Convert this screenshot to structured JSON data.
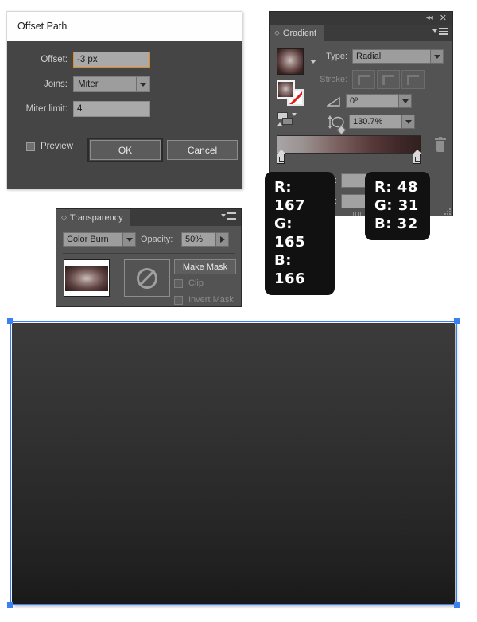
{
  "dialog": {
    "title": "Offset Path",
    "fields": [
      {
        "label": "Offset:",
        "value": "-3 px"
      },
      {
        "label": "Joins:",
        "value": "Miter"
      },
      {
        "label": "Miter limit:",
        "value": "4"
      }
    ],
    "preview_label": "Preview",
    "ok_label": "OK",
    "cancel_label": "Cancel"
  },
  "gradient_panel": {
    "tab_label": "Gradient",
    "type_label": "Type:",
    "type_value": "Radial",
    "stroke_label": "Stroke:",
    "angle_value": "0º",
    "aspect_value": "130.7%",
    "opacity_label": "ty:",
    "location_label": "n:",
    "collapse_icon": "◂◂",
    "close_icon": "✕",
    "gradient_start_color": "#a7a5a6",
    "gradient_end_color": "#302020"
  },
  "transparency_panel": {
    "tab_label": "Transparency",
    "blend_mode": "Color Burn",
    "opacity_label": "Opacity:",
    "opacity_value": "50%",
    "make_mask_label": "Make Mask",
    "clip_label": "Clip",
    "invert_mask_label": "Invert Mask"
  },
  "overlays": [
    {
      "name": "light-stop-rgb",
      "r": "R: 167",
      "g": "G: 165",
      "b": "B: 166"
    },
    {
      "name": "dark-stop-rgb",
      "r": "R: 48",
      "g": "G: 31",
      "b": "B: 32"
    }
  ],
  "artboard": {
    "selection_color": "#3b7ff0",
    "fill_top_color": "#3b3b3b",
    "fill_bottom_color": "#191919"
  }
}
